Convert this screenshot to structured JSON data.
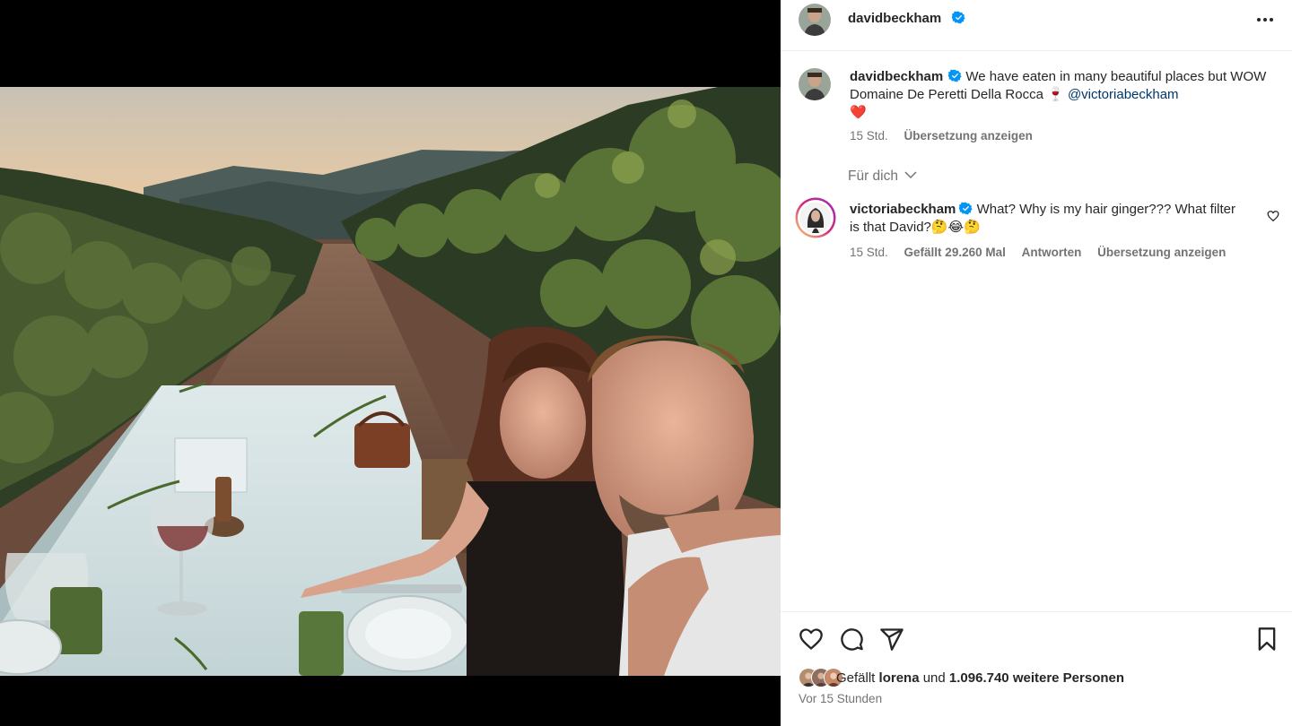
{
  "header": {
    "username": "davidbeckham",
    "more_icon": "more-horizontal-icon"
  },
  "caption": {
    "username": "davidbeckham",
    "text": "We have eaten in many beautiful places but WOW Domaine De Peretti Della Rocca 🍷",
    "mention": "@victoriabeckham",
    "emoji": "❤️",
    "time": "15 Std.",
    "translate": "Übersetzung anzeigen"
  },
  "comments_filter": {
    "label": "Für dich"
  },
  "comment": {
    "username": "victoriabeckham",
    "text": "What? Why is my hair ginger??? What filter is that David?🤔😂🤔",
    "time": "15 Std.",
    "likes": "Gefällt 29.260 Mal",
    "reply": "Antworten",
    "translate": "Übersetzung anzeigen"
  },
  "actions": {
    "icons": [
      "heart-icon",
      "comment-icon",
      "share-icon",
      "bookmark-icon"
    ]
  },
  "likes": {
    "prefix": "Gefällt",
    "user": "lorena",
    "middle": "und",
    "count": "1.096.740 weitere Personen"
  },
  "posted": "Vor 15 Stunden",
  "colors": {
    "verified": "#0095f6",
    "heart_red": "#ed4956",
    "mention": "#00376b",
    "muted": "#737373"
  }
}
